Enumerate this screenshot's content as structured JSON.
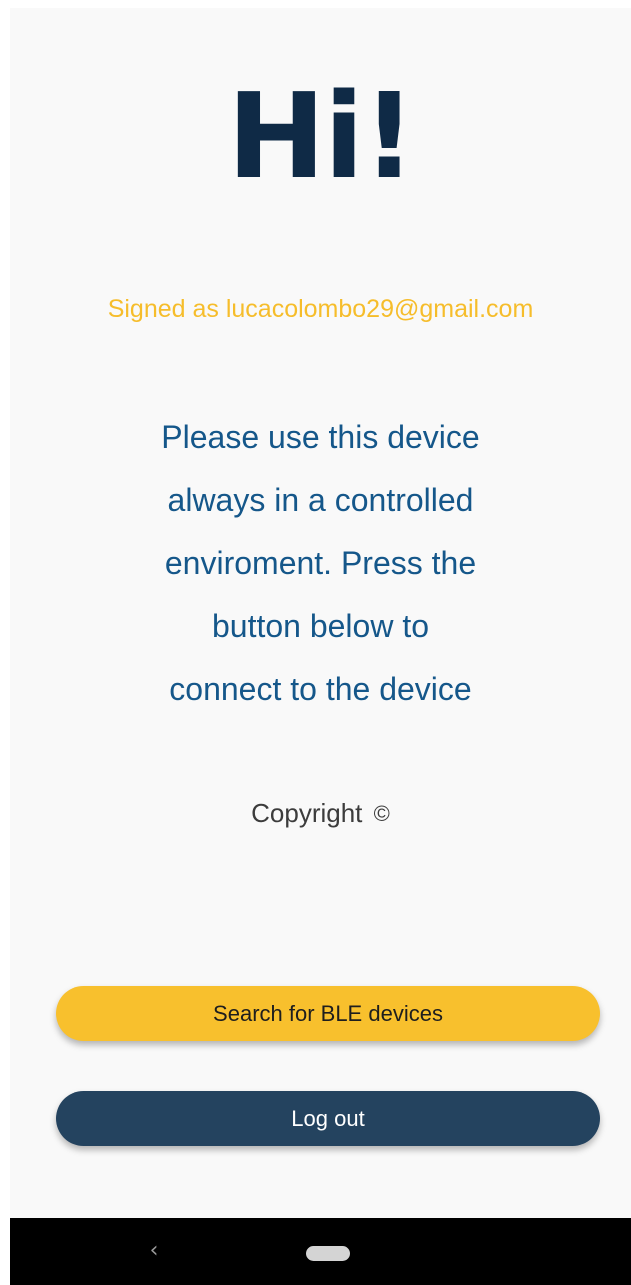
{
  "greeting": "Hi!",
  "signed_in": "Signed as lucacolombo29@gmail.com",
  "notice_lines": [
    "Please use this device",
    "always in a controlled",
    "enviroment. Press the",
    "button below to",
    "connect to the device"
  ],
  "copyright": {
    "label": "Copyright",
    "symbol": "©"
  },
  "buttons": {
    "search_label": "Search for BLE devices",
    "logout_label": "Log out"
  },
  "navbar": {
    "back_glyph": "‹",
    "back_icon": "back-chevron-icon",
    "home_icon": "home-pill-icon"
  },
  "colors": {
    "greeting": "#0f2a46",
    "signed_in": "#f6bd2b",
    "notice": "#15578a",
    "search_button": "#f8c02d",
    "logout_button": "#24435f",
    "background": "#f9f9f9",
    "navbar": "#000000"
  }
}
